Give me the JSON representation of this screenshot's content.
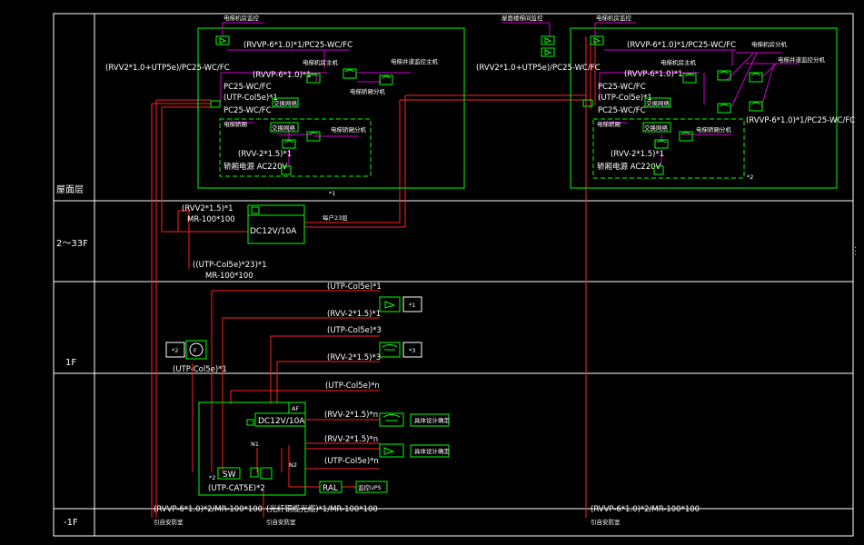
{
  "floors": {
    "roof": "屋面层",
    "mid": "2～33F",
    "f1": "1F",
    "b1": "-1F"
  },
  "colors": {
    "frame": "#ffffff",
    "box": "#00ff00",
    "wire": "#ff2020",
    "drop": "#d000d0",
    "text": "#ffffff"
  },
  "left_unit": {
    "camera_label": "电梯机房监控",
    "cable_main": "(RVVP-6*1.0)*1/PC25-WC/FC",
    "cable_left": "(RVV2*1.0+UTP5e)/PC25-WC/FC",
    "cable_mid": "(RVVP-6*1.0)*1",
    "conduit": "PC25-WC/FC",
    "utp": "(UTP-Col5e)*1",
    "conduit2": "PC25-WC/FC",
    "main_machine": "电梯机房主机",
    "car_device": "电梯井道监控主机",
    "shaft_device": "电梯轿厢分机",
    "net_switch": "交换网络",
    "shaft_area": "电梯轿厢",
    "switch_inner": "交换网络",
    "car_sub": "电梯轿厢分机",
    "rvv": "(RVV-2*1.5)*1",
    "power": "轿厢电源 AC220V",
    "note": "*1"
  },
  "right_unit": {
    "top_label": "屋面楼梯间监控",
    "camera_label": "电梯机房监控",
    "cable_main": "(RVVP-6*1.0)*1/PC25-WC/FC",
    "cable_left": "(RVV2*1.0+UTP5e)/PC25-WC/FC",
    "cable_mid": "(RVVP-6*1.0)*1",
    "conduit": "PC25-WC/FC",
    "utp": "(UTP-Col5e)*1",
    "conduit2": "PC25-WC/FC",
    "main_machine": "电梯机房主机",
    "machine_sub": "电梯机房分机",
    "shaft_device": "电梯井道监控分机",
    "net_switch": "交换网络",
    "shaft_area": "电梯轿厢",
    "switch_inner": "交换网络",
    "car_sub": "电梯轿厢分机",
    "rvv": "(RVV-2*1.5)*1",
    "power": "轿厢电源 AC220V",
    "cable_right": "(RVVP-6*1.0)*1/PC25-WC/FC",
    "note": "*2"
  },
  "mid_box": {
    "label": "DC12V/10A",
    "cable_top": "(RVV2*1.5)*1",
    "cable_mr": "MR-100*100",
    "cable_utp": "((UTP-Col5e)*23)*1",
    "cable_mr2": "MR-100*100",
    "right_label": "每户23层"
  },
  "f1_feeds": {
    "feed1": "(UTP-Col5e)*1",
    "feed1_tag": "*1",
    "feed2": "(RVV-2*1.5)*1",
    "feed3": "(UTP-Col5e)*3",
    "feed4": "(RVV-2*1.5)*3",
    "feed4_tag": "*3",
    "phone_tag": "*2",
    "phone_symbol": "F",
    "phone_cable": "(UTP-Col5e)*1"
  },
  "control_box": {
    "af": "AF",
    "dc": "DC12V/10A",
    "n1": "N1",
    "n2": "N2",
    "sw": "SW",
    "sw_tag": "*2",
    "utp_cat": "(UTP-CAT5E)*2",
    "ral": "RAL",
    "ups": "监控UPS",
    "out1": "(UTP-Col5e)*n",
    "out2": "(RVV-2*1.5)*n",
    "out3": "(RVV-2*1.5)*n",
    "out4": "(UTP-Col5e)*n",
    "dev1": "具体设计确定",
    "dev2": "具体设计确定"
  },
  "bottom": {
    "left_cable": "(RVVP-6*1.0)*2/MR-100*100",
    "left_dest": "引自安防室",
    "mid_cable": "(光纤铜缆光缆)*1/MR-100*100",
    "mid_dest": "引自安防室",
    "right_cable": "(RVVP-6*1.0)*2/MR-100*100",
    "right_dest": "引自安防室"
  }
}
